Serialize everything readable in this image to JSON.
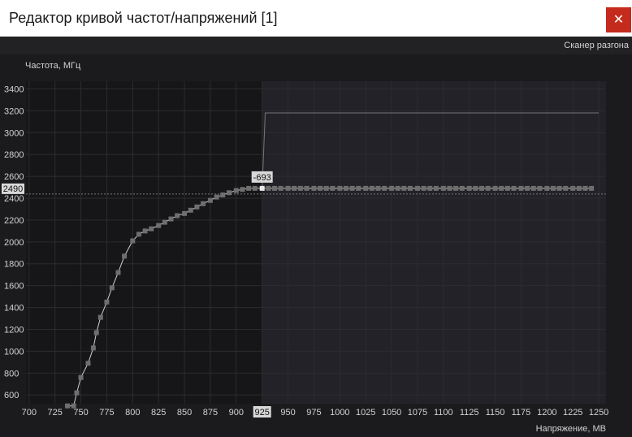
{
  "window": {
    "title": "Редактор кривой частот/напряжений [1]",
    "close_glyph": "✕"
  },
  "toolbar": {
    "scanner_label": "Сканер разгона"
  },
  "colors": {
    "background": "#1b1b1d",
    "plot_bg": "#161618",
    "locked_region": "#222228",
    "grid": "#2c2c30",
    "curve": "#cfcfcf",
    "point": "#6e6e6e",
    "selected_point": "#e8e8e8",
    "tick_text": "#d2d2d2",
    "close_button": "#c42b1c"
  },
  "chart_data": {
    "type": "line",
    "xlabel": "Напряжение, МВ",
    "ylabel": "Частота, МГц",
    "xlim": [
      697,
      1257
    ],
    "ylim": [
      520,
      3470
    ],
    "x_ticks": [
      700,
      725,
      750,
      775,
      800,
      825,
      850,
      875,
      900,
      925,
      950,
      975,
      1000,
      1025,
      1050,
      1075,
      1100,
      1125,
      1150,
      1175,
      1200,
      1225,
      1250
    ],
    "y_ticks": [
      600,
      800,
      1000,
      1200,
      1400,
      1600,
      1800,
      2000,
      2200,
      2400,
      2600,
      2800,
      3000,
      3200,
      3400
    ],
    "selected_point": {
      "x": 925,
      "y": 2490,
      "label": "-693"
    },
    "x_readout": "925",
    "y_readout": "2490",
    "locked_from_x": 925,
    "reference_line": [
      [
        925,
        2490
      ],
      [
        928,
        3180
      ],
      [
        1250,
        3180
      ]
    ],
    "series": [
      {
        "points": [
          [
            737,
            500
          ],
          [
            743,
            500
          ],
          [
            746,
            620
          ],
          [
            750,
            760
          ],
          [
            757,
            890
          ],
          [
            762,
            1030
          ],
          [
            765,
            1170
          ],
          [
            769,
            1310
          ],
          [
            775,
            1450
          ],
          [
            780,
            1580
          ],
          [
            786,
            1720
          ],
          [
            792,
            1870
          ],
          [
            800,
            2010
          ],
          [
            806,
            2070
          ],
          [
            812,
            2100
          ],
          [
            818,
            2120
          ],
          [
            825,
            2150
          ],
          [
            831,
            2180
          ],
          [
            837,
            2210
          ],
          [
            843,
            2240
          ],
          [
            850,
            2260
          ],
          [
            856,
            2290
          ],
          [
            862,
            2320
          ],
          [
            868,
            2350
          ],
          [
            875,
            2380
          ],
          [
            881,
            2410
          ],
          [
            887,
            2430
          ],
          [
            893,
            2450
          ],
          [
            900,
            2470
          ],
          [
            906,
            2480
          ],
          [
            912,
            2490
          ],
          [
            918,
            2490
          ],
          [
            925,
            2490
          ],
          [
            931,
            2490
          ],
          [
            937,
            2490
          ],
          [
            943,
            2490
          ],
          [
            950,
            2490
          ],
          [
            956,
            2490
          ],
          [
            962,
            2490
          ],
          [
            968,
            2490
          ],
          [
            975,
            2490
          ],
          [
            981,
            2490
          ],
          [
            987,
            2490
          ],
          [
            993,
            2490
          ],
          [
            1000,
            2490
          ],
          [
            1006,
            2490
          ],
          [
            1012,
            2490
          ],
          [
            1018,
            2490
          ],
          [
            1025,
            2490
          ],
          [
            1031,
            2490
          ],
          [
            1037,
            2490
          ],
          [
            1043,
            2490
          ],
          [
            1050,
            2490
          ],
          [
            1056,
            2490
          ],
          [
            1062,
            2490
          ],
          [
            1068,
            2490
          ],
          [
            1075,
            2490
          ],
          [
            1081,
            2490
          ],
          [
            1087,
            2490
          ],
          [
            1093,
            2490
          ],
          [
            1100,
            2490
          ],
          [
            1106,
            2490
          ],
          [
            1112,
            2490
          ],
          [
            1118,
            2490
          ],
          [
            1125,
            2490
          ],
          [
            1131,
            2490
          ],
          [
            1137,
            2490
          ],
          [
            1143,
            2490
          ],
          [
            1150,
            2490
          ],
          [
            1156,
            2490
          ],
          [
            1162,
            2490
          ],
          [
            1168,
            2490
          ],
          [
            1175,
            2490
          ],
          [
            1181,
            2490
          ],
          [
            1187,
            2490
          ],
          [
            1193,
            2490
          ],
          [
            1200,
            2490
          ],
          [
            1206,
            2490
          ],
          [
            1212,
            2490
          ],
          [
            1218,
            2490
          ],
          [
            1225,
            2490
          ],
          [
            1231,
            2490
          ],
          [
            1237,
            2490
          ],
          [
            1243,
            2490
          ]
        ]
      }
    ]
  }
}
